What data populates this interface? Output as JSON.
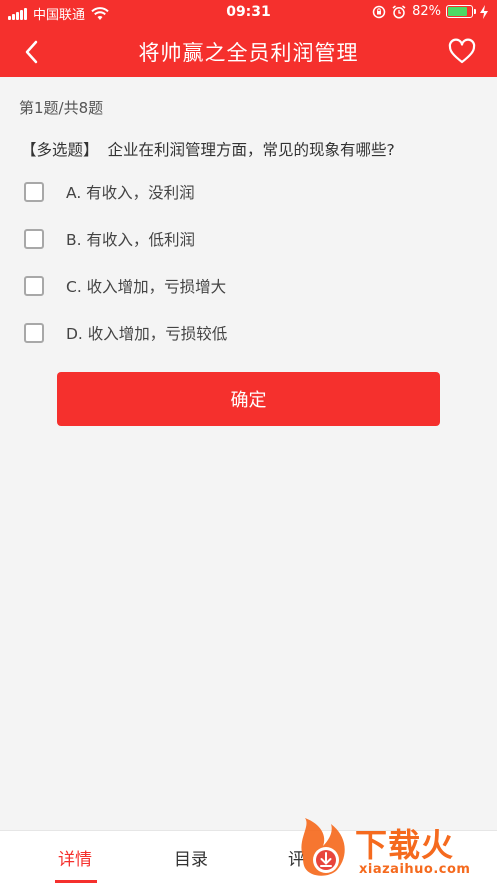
{
  "status_bar": {
    "carrier": "中国联通",
    "time": "09:31",
    "battery_percent": "82%",
    "battery_level": 0.82
  },
  "navbar": {
    "title": "将帅赢之全员利润管理",
    "back_icon": "chevron-left-icon",
    "favorite_icon": "heart-outline-icon"
  },
  "quiz": {
    "counter": "第1题/共8题",
    "question_type": "【多选题】",
    "question_text": "企业在利润管理方面，常见的现象有哪些?",
    "options": [
      {
        "label": "A. 有收入，没利润",
        "checked": false
      },
      {
        "label": "B. 有收入，低利润",
        "checked": false
      },
      {
        "label": "C. 收入增加，亏损增大",
        "checked": false
      },
      {
        "label": "D. 收入增加，亏损较低",
        "checked": false
      }
    ],
    "confirm_label": "确定"
  },
  "tabbar": {
    "tabs": [
      {
        "label": "详情",
        "active": true
      },
      {
        "label": "目录",
        "active": false
      },
      {
        "label": "评",
        "active": false
      }
    ]
  },
  "watermark": {
    "brand": "下载火",
    "domain": "xiazaihuo.com"
  },
  "colors": {
    "accent": "#f5302d",
    "background": "#f4f4f4",
    "watermark": "#f56a1e"
  }
}
